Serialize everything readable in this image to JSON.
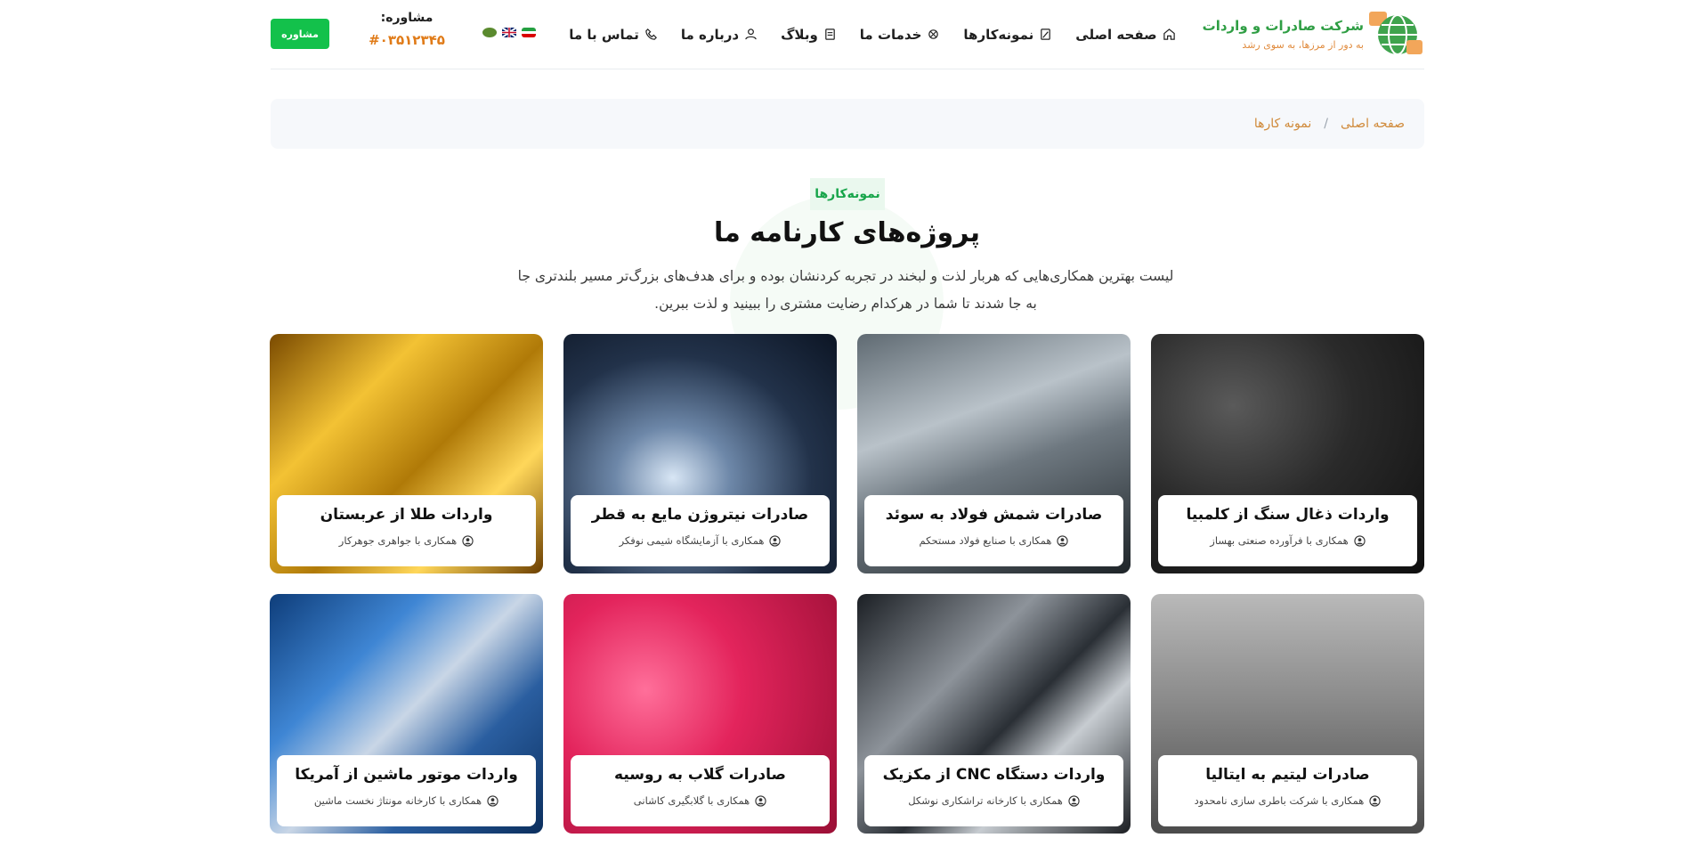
{
  "header": {
    "logo": {
      "title": "شرکت صادرات و واردات",
      "subtitle": "به دور از مرزها، به سوی رشد"
    },
    "nav": [
      {
        "label": "صفحه اصلی",
        "icon": "home-icon"
      },
      {
        "label": "نمونه‌کارها",
        "icon": "portfolio-icon"
      },
      {
        "label": "خدمات ما",
        "icon": "services-icon"
      },
      {
        "label": "وبلاگ",
        "icon": "blog-icon"
      },
      {
        "label": "درباره ما",
        "icon": "users-icon"
      },
      {
        "label": "تماس با ما",
        "icon": "phone-icon"
      }
    ],
    "consult": {
      "label": "مشاوره:",
      "number": "#۰۳۵۱۲۳۴۵",
      "button": "مشاوره"
    }
  },
  "breadcrumb": {
    "home": "صفحه اصلی",
    "separator": "/",
    "current": "نمونه کارها"
  },
  "section": {
    "eyebrow": "نمونه‌کارها",
    "title": "پروژه‌های کارنامه ما",
    "lead": "لیست بهترین همکاری‌هایی که هربار لذت و لبخند در تجربه کردنشان بوده و برای هدف‌های بزرگ‌تر مسیر بلندتری جا به جا شدند تا شما در هرکدام رضایت مشتری را ببینید و لذت ببرین."
  },
  "projects": [
    {
      "title": "واردات ذغال سنگ از کلمبیا",
      "meta": "همکاری با فرآورده صنعتی بهساز",
      "image": "coal"
    },
    {
      "title": "صادرات شمش فولاد به سوئد",
      "meta": "همکاری با صنایع فولاد مستحکم",
      "image": "steel"
    },
    {
      "title": "صادرات نیتروژن مایع به قطر",
      "meta": "همکاری با آزمایشگاه شیمی نوفکر",
      "image": "nitro"
    },
    {
      "title": "واردات طلا از عربستان",
      "meta": "همکاری با جواهری جوهرکار",
      "image": "gold"
    },
    {
      "title": "صادرات لیتیم به ایتالیا",
      "meta": "همکاری با شرکت باطری سازی نامحدود",
      "image": "lith"
    },
    {
      "title": "واردات دستگاه CNC از مکزیک",
      "meta": "همکاری با کارخانه تراشکاری نوشکل",
      "image": "cnc"
    },
    {
      "title": "صادرات گلاب به روسیه",
      "meta": "همکاری با گلابگیری کاشانی",
      "image": "rose"
    },
    {
      "title": "واردات موتور ماشین از آمریکا",
      "meta": "همکاری با کارخانه مونتاژ نخست ماشین",
      "image": "engine"
    }
  ],
  "colors": {
    "accent": "#13c14b",
    "brand": "#2f9e44",
    "orange": "#e07b18"
  }
}
